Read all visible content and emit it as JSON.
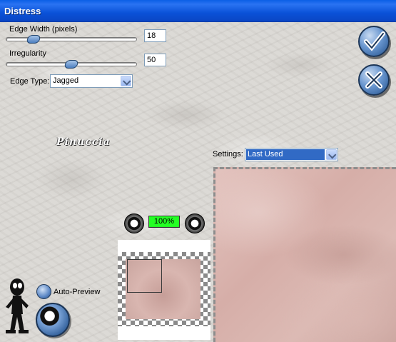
{
  "window": {
    "title": "Distress"
  },
  "controls": {
    "edge_width": {
      "label": "Edge Width (pixels)",
      "value": "18",
      "slider_fraction": 0.18
    },
    "irregularity": {
      "label": "Irregularity",
      "value": "50",
      "slider_fraction": 0.5
    },
    "edge_type": {
      "label": "Edge Type:",
      "selected": "Jagged"
    },
    "settings": {
      "label": "Settings:",
      "selected": "Last Used"
    }
  },
  "preview": {
    "zoom": "100%",
    "auto_preview_label": "Auto-Preview"
  },
  "signature": "Pinuccia",
  "icons": {
    "ok": "ok-checkmark-icon",
    "cancel": "cancel-x-icon",
    "zoom_out": "zoom-out-icon",
    "zoom_in": "zoom-in-icon",
    "help": "help-figure-icon",
    "preview_toggle": "eye-icon"
  },
  "colors": {
    "titlebar": "#0a52d8",
    "zoom_badge": "#24ff24",
    "selection": "#316ac5"
  }
}
